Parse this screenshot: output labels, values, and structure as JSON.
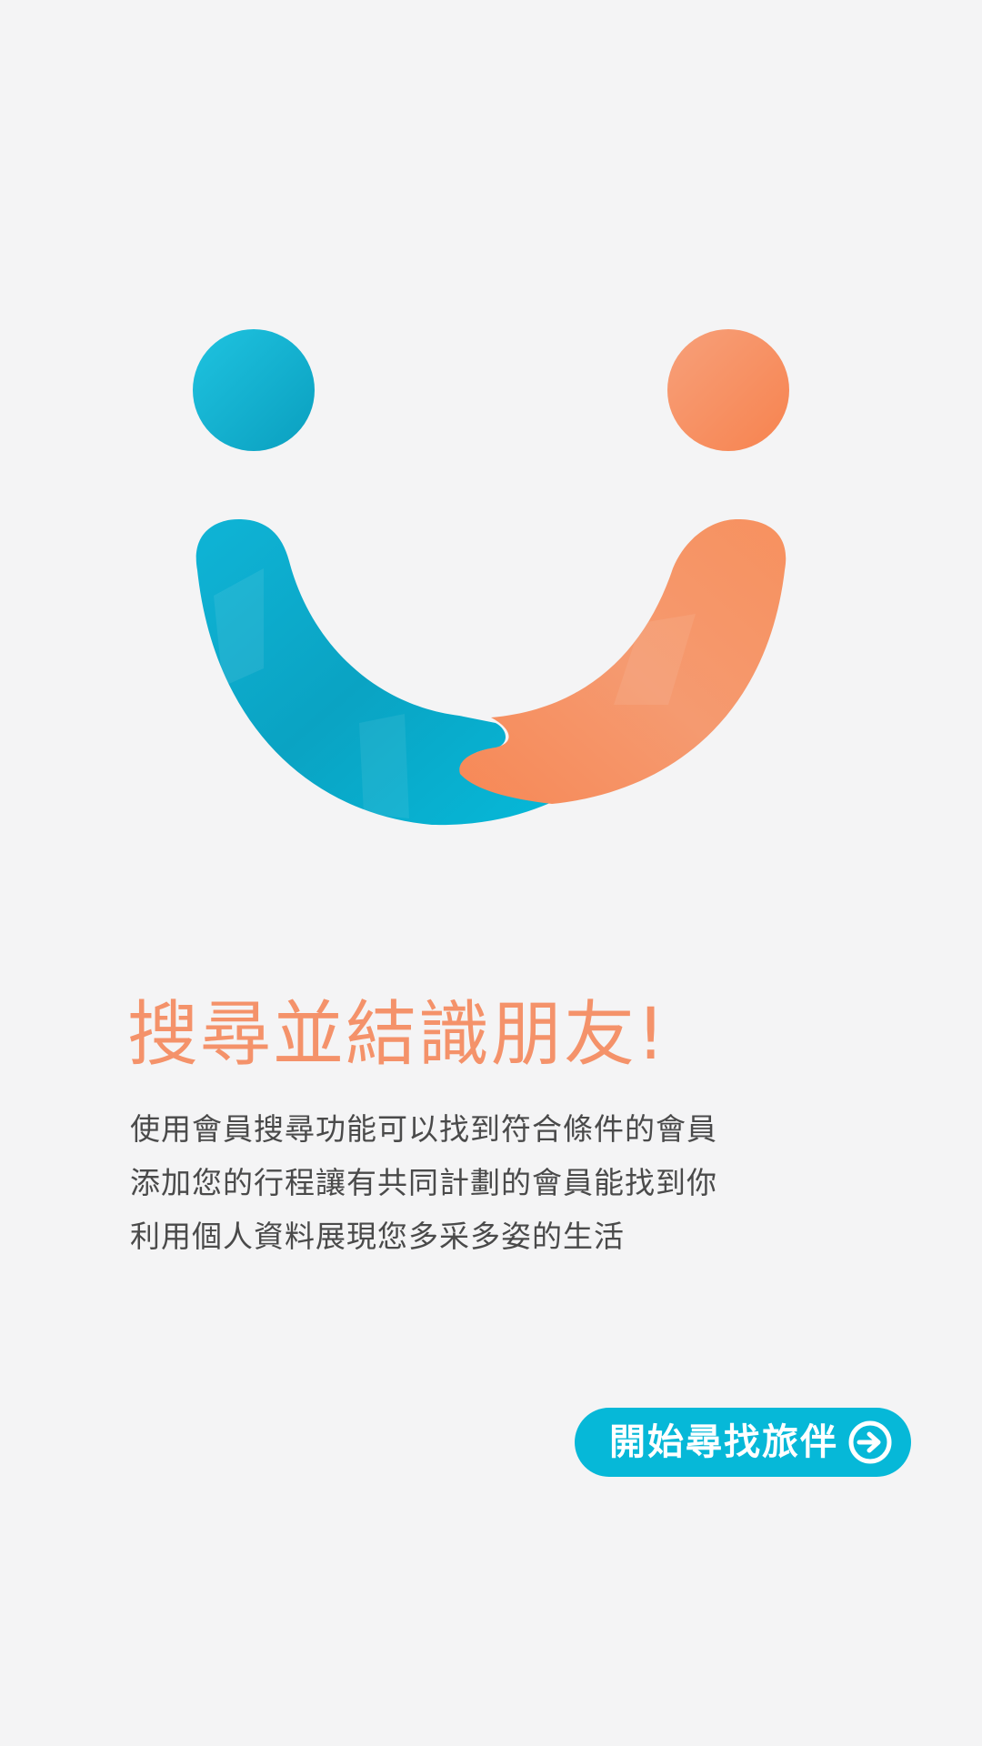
{
  "onboarding": {
    "title": "搜尋並結識朋友!",
    "description_lines": [
      "使用會員搜尋功能可以找到符合條件的會員",
      "添加您的行程讓有共同計劃的會員能找到你",
      "利用個人資料展現您多采多姿的生活"
    ],
    "cta_label": "開始尋找旅伴",
    "cta_icon": "arrow-circle-right-icon",
    "logo_icon": "smiling-face-logo"
  },
  "colors": {
    "background": "#f4f4f5",
    "accent_blue": "#06b8d8",
    "accent_orange": "#f4926a",
    "text": "#4a4a4a"
  }
}
